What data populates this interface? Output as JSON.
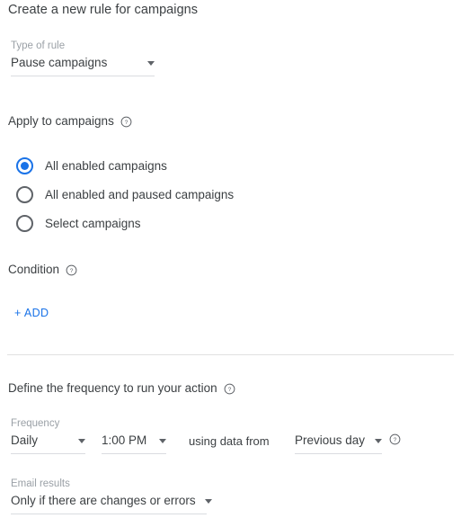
{
  "page": {
    "title": "Create a new rule for campaigns"
  },
  "rule_type": {
    "label": "Type of rule",
    "value": "Pause campaigns",
    "caret_icon": "chevron-down-icon"
  },
  "apply_to": {
    "heading": "Apply to campaigns",
    "help_icon": "help-circle-icon",
    "options": [
      {
        "label": "All enabled campaigns",
        "selected": true
      },
      {
        "label": "All enabled and paused campaigns",
        "selected": false
      },
      {
        "label": "Select campaigns",
        "selected": false
      }
    ]
  },
  "condition": {
    "heading": "Condition",
    "help_icon": "help-circle-icon",
    "add_label": "+ ADD"
  },
  "frequency_section": {
    "heading": "Define the frequency to run your action",
    "help_icon": "help-circle-icon",
    "frequency": {
      "label": "Frequency",
      "value": "Daily",
      "caret_icon": "chevron-down-icon"
    },
    "time": {
      "value": "1:00 PM",
      "caret_icon": "chevron-down-icon"
    },
    "using_data_from_label": "using data from",
    "data_range": {
      "value": "Previous day",
      "caret_icon": "chevron-down-icon"
    },
    "data_range_help_icon": "help-circle-icon"
  },
  "email_results": {
    "label": "Email results",
    "value": "Only if there are changes or errors",
    "caret_icon": "chevron-down-icon"
  },
  "colors": {
    "accent": "#1a73e8",
    "text": "#3c4043",
    "muted": "#9aa0a6",
    "line": "#dadce0"
  }
}
